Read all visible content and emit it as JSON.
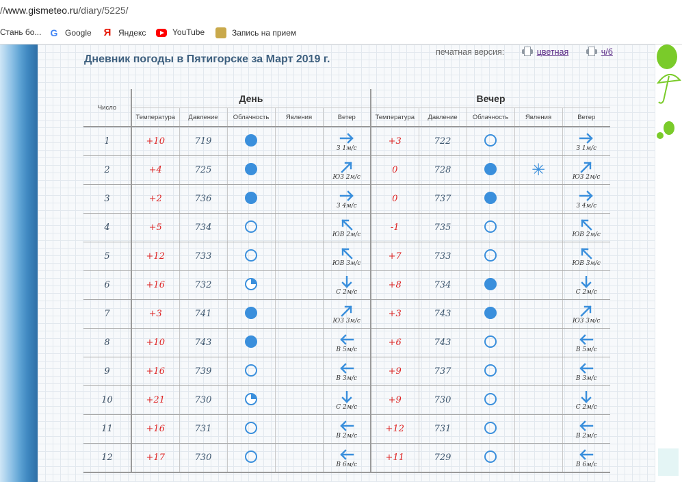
{
  "browser": {
    "url_scheme": "//",
    "url_host": "www.gismeteo.ru",
    "url_path": "/diary/5225/"
  },
  "bookmarks": [
    {
      "label": "Стань бо...",
      "icon": "none"
    },
    {
      "label": "Google",
      "icon": "google-icon"
    },
    {
      "label": "Яндекс",
      "icon": "yandex-icon"
    },
    {
      "label": "YouTube",
      "icon": "youtube-icon"
    },
    {
      "label": "Запись на прием",
      "icon": "gov-icon"
    }
  ],
  "page": {
    "title": "Дневник погоды в Пятигорске за Март 2019 г.",
    "print_label": "печатная версия:",
    "print_color": "цветная",
    "print_bw": "ч/б"
  },
  "table": {
    "col_day": "Число",
    "group_day": "День",
    "group_evening": "Вечер",
    "sub_headers": [
      "Температура",
      "Давление",
      "Облачность",
      "Явления",
      "Ветер"
    ],
    "rows": [
      {
        "day": "1",
        "d_temp": "+10",
        "d_press": "719",
        "d_cloud": "full",
        "d_phen": "",
        "d_wdir": "E",
        "d_wind": "З 1м/с",
        "e_temp": "+3",
        "e_press": "722",
        "e_cloud": "clear",
        "e_phen": "",
        "e_wdir": "E",
        "e_wind": "З 1м/с"
      },
      {
        "day": "2",
        "d_temp": "+4",
        "d_press": "725",
        "d_cloud": "full",
        "d_phen": "",
        "d_wdir": "NE",
        "d_wind": "ЮЗ 2м/с",
        "e_temp": "0",
        "e_press": "728",
        "e_cloud": "full",
        "e_phen": "snow",
        "e_wdir": "NE",
        "e_wind": "ЮЗ 2м/с"
      },
      {
        "day": "3",
        "d_temp": "+2",
        "d_press": "736",
        "d_cloud": "full",
        "d_phen": "",
        "d_wdir": "E",
        "d_wind": "З 4м/с",
        "e_temp": "0",
        "e_press": "737",
        "e_cloud": "full",
        "e_phen": "",
        "e_wdir": "E",
        "e_wind": "З 4м/с"
      },
      {
        "day": "4",
        "d_temp": "+5",
        "d_press": "734",
        "d_cloud": "clear",
        "d_phen": "",
        "d_wdir": "NW",
        "d_wind": "ЮВ 2м/с",
        "e_temp": "-1",
        "e_press": "735",
        "e_cloud": "clear",
        "e_phen": "",
        "e_wdir": "NW",
        "e_wind": "ЮВ 2м/с"
      },
      {
        "day": "5",
        "d_temp": "+12",
        "d_press": "733",
        "d_cloud": "clear",
        "d_phen": "",
        "d_wdir": "NW",
        "d_wind": "ЮВ 3м/с",
        "e_temp": "+7",
        "e_press": "733",
        "e_cloud": "clear",
        "e_phen": "",
        "e_wdir": "NW",
        "e_wind": "ЮВ 3м/с"
      },
      {
        "day": "6",
        "d_temp": "+16",
        "d_press": "732",
        "d_cloud": "quarter",
        "d_phen": "",
        "d_wdir": "S",
        "d_wind": "С 2м/с",
        "e_temp": "+8",
        "e_press": "734",
        "e_cloud": "full",
        "e_phen": "",
        "e_wdir": "S",
        "e_wind": "С 2м/с"
      },
      {
        "day": "7",
        "d_temp": "+3",
        "d_press": "741",
        "d_cloud": "full",
        "d_phen": "",
        "d_wdir": "NE",
        "d_wind": "ЮЗ 3м/с",
        "e_temp": "+3",
        "e_press": "743",
        "e_cloud": "full",
        "e_phen": "",
        "e_wdir": "NE",
        "e_wind": "ЮЗ 3м/с"
      },
      {
        "day": "8",
        "d_temp": "+10",
        "d_press": "743",
        "d_cloud": "full",
        "d_phen": "",
        "d_wdir": "W",
        "d_wind": "В 5м/с",
        "e_temp": "+6",
        "e_press": "743",
        "e_cloud": "clear",
        "e_phen": "",
        "e_wdir": "W",
        "e_wind": "В 5м/с"
      },
      {
        "day": "9",
        "d_temp": "+16",
        "d_press": "739",
        "d_cloud": "clear",
        "d_phen": "",
        "d_wdir": "W",
        "d_wind": "В 3м/с",
        "e_temp": "+9",
        "e_press": "737",
        "e_cloud": "clear",
        "e_phen": "",
        "e_wdir": "W",
        "e_wind": "В 3м/с"
      },
      {
        "day": "10",
        "d_temp": "+21",
        "d_press": "730",
        "d_cloud": "quarter",
        "d_phen": "",
        "d_wdir": "S",
        "d_wind": "С 2м/с",
        "e_temp": "+9",
        "e_press": "730",
        "e_cloud": "clear",
        "e_phen": "",
        "e_wdir": "S",
        "e_wind": "С 2м/с"
      },
      {
        "day": "11",
        "d_temp": "+16",
        "d_press": "731",
        "d_cloud": "clear",
        "d_phen": "",
        "d_wdir": "W",
        "d_wind": "В 2м/с",
        "e_temp": "+12",
        "e_press": "731",
        "e_cloud": "clear",
        "e_phen": "",
        "e_wdir": "W",
        "e_wind": "В 2м/с"
      },
      {
        "day": "12",
        "d_temp": "+17",
        "d_press": "730",
        "d_cloud": "clear",
        "d_phen": "",
        "d_wdir": "W",
        "d_wind": "В 6м/с",
        "e_temp": "+11",
        "e_press": "729",
        "e_cloud": "clear",
        "e_phen": "",
        "e_wdir": "W",
        "e_wind": "В 6м/с"
      }
    ]
  },
  "colors": {
    "accent": "#3a8fdc",
    "temp": "#dd2222",
    "title": "#3d5f7e",
    "link": "#5a2a86"
  }
}
